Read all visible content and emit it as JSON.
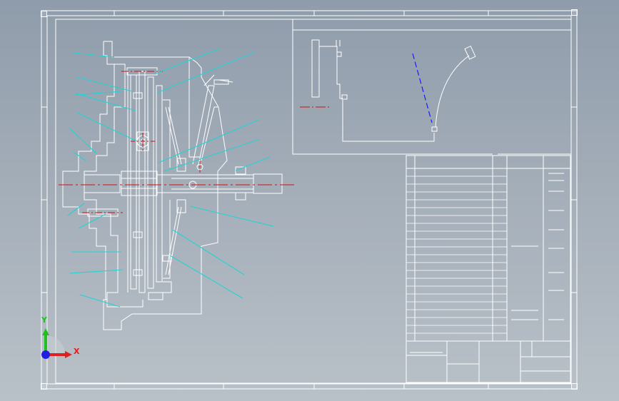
{
  "viewport": {
    "background_top": "#8f9cab",
    "background_bottom": "#b9c1c8",
    "line_color": "#ffffff",
    "leader_color": "#22d3d3",
    "centerline_color": "#d01010",
    "dashed_color": "#1010ff"
  },
  "drawing": {
    "title_block_rows": 22,
    "title_block_columns": 4
  },
  "triad": {
    "x_label": "X",
    "y_label": "Y",
    "x_color": "#e02020",
    "y_color": "#20c020",
    "z_color": "#2020e0"
  },
  "icons": {
    "corner_markers": "viewport-corner-marker"
  }
}
